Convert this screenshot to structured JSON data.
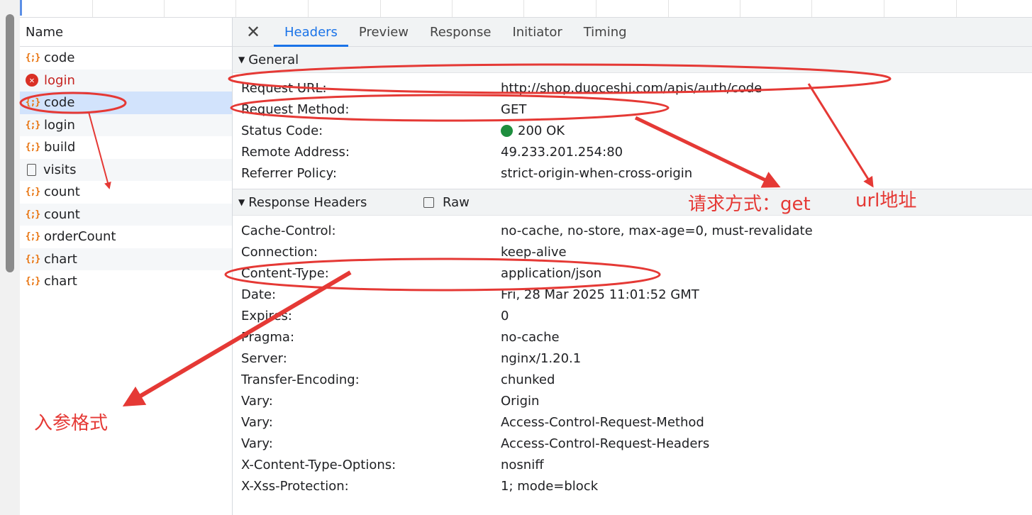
{
  "network": {
    "name_header": "Name",
    "requests": [
      {
        "name": "code",
        "icon": "fetch-icon",
        "status": "ok"
      },
      {
        "name": "login",
        "icon": "error-icon",
        "status": "error"
      },
      {
        "name": "code",
        "icon": "fetch-icon",
        "status": "selected"
      },
      {
        "name": "login",
        "icon": "fetch-icon",
        "status": "ok"
      },
      {
        "name": "build",
        "icon": "fetch-icon",
        "status": "ok"
      },
      {
        "name": "visits",
        "icon": "document-icon",
        "status": "ok"
      },
      {
        "name": "count",
        "icon": "fetch-icon",
        "status": "ok"
      },
      {
        "name": "count",
        "icon": "fetch-icon",
        "status": "ok"
      },
      {
        "name": "orderCount",
        "icon": "fetch-icon",
        "status": "ok"
      },
      {
        "name": "chart",
        "icon": "fetch-icon",
        "status": "ok"
      },
      {
        "name": "chart",
        "icon": "fetch-icon",
        "status": "ok"
      }
    ]
  },
  "details": {
    "close_glyph": "✕",
    "tabs": [
      "Headers",
      "Preview",
      "Response",
      "Initiator",
      "Timing"
    ],
    "active_tab": "Headers",
    "general": {
      "title": "General",
      "rows": [
        {
          "k": "Request URL:",
          "v": "http://shop.duoceshi.com/apis/auth/code"
        },
        {
          "k": "Request Method:",
          "v": "GET"
        },
        {
          "k": "Status Code:",
          "v": "200 OK"
        },
        {
          "k": "Remote Address:",
          "v": "49.233.201.254:80"
        },
        {
          "k": "Referrer Policy:",
          "v": "strict-origin-when-cross-origin"
        }
      ]
    },
    "response": {
      "title": "Response Headers",
      "raw_label": "Raw",
      "rows": [
        {
          "k": "Cache-Control:",
          "v": "no-cache, no-store, max-age=0, must-revalidate"
        },
        {
          "k": "Connection:",
          "v": "keep-alive"
        },
        {
          "k": "Content-Type:",
          "v": "application/json"
        },
        {
          "k": "Date:",
          "v": "Fri, 28 Mar 2025 11:01:52 GMT"
        },
        {
          "k": "Expires:",
          "v": "0"
        },
        {
          "k": "Pragma:",
          "v": "no-cache"
        },
        {
          "k": "Server:",
          "v": "nginx/1.20.1"
        },
        {
          "k": "Transfer-Encoding:",
          "v": "chunked"
        },
        {
          "k": "Vary:",
          "v": "Origin"
        },
        {
          "k": "Vary:",
          "v": "Access-Control-Request-Method"
        },
        {
          "k": "Vary:",
          "v": "Access-Control-Request-Headers"
        },
        {
          "k": "X-Content-Type-Options:",
          "v": "nosniff"
        },
        {
          "k": "X-Xss-Protection:",
          "v": "1; mode=block"
        }
      ]
    }
  },
  "annotations": {
    "method_note": "请求方式：get",
    "url_note": "url地址",
    "content_type_note": "入参格式"
  },
  "colors": {
    "accent": "#1a73e8",
    "annotation_red": "#e53935",
    "status_green": "#1e8e3e",
    "error_red": "#d93025"
  }
}
